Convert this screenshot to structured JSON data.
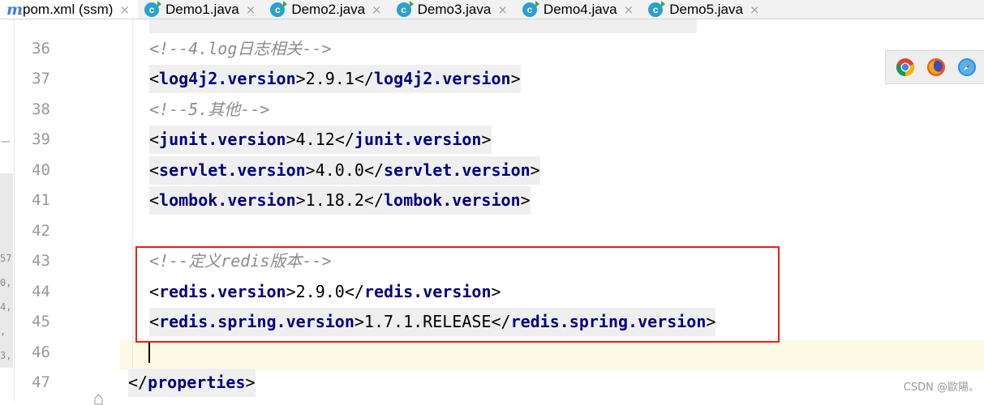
{
  "tabs": [
    {
      "label": "pom.xml (ssm)",
      "icon": "maven-file-icon",
      "active": true,
      "close": "×"
    },
    {
      "label": "Demo1.java",
      "icon": "java-class-icon",
      "close": "×"
    },
    {
      "label": "Demo2.java",
      "icon": "java-class-icon",
      "close": "×"
    },
    {
      "label": "Demo3.java",
      "icon": "java-class-icon",
      "close": "×"
    },
    {
      "label": "Demo4.java",
      "icon": "java-class-icon",
      "close": "×"
    },
    {
      "label": "Demo5.java",
      "icon": "java-class-icon",
      "close": "×"
    }
  ],
  "icons": {
    "maven": "m",
    "java_class": "c"
  },
  "left_strip_peek": [
    "57,",
    "0,",
    "4,",
    ",",
    "3,"
  ],
  "gutter": [
    "36",
    "37",
    "38",
    "39",
    "40",
    "41",
    "42",
    "43",
    "44",
    "45",
    "46",
    "47"
  ],
  "code": {
    "l36": {
      "text": "<!--4.log日志相关-->"
    },
    "l37": {
      "open": "<",
      "tag": "log4j2.version",
      "mid1": ">",
      "value": "2.9.1",
      "close_open": "</",
      "close_tag": "log4j2.version",
      "end": ">"
    },
    "l38": {
      "text": "<!--5.其他-->"
    },
    "l39": {
      "open": "<",
      "tag": "junit.version",
      "mid1": ">",
      "value": "4.12",
      "close_open": "</",
      "close_tag": "junit.version",
      "end": ">"
    },
    "l40": {
      "open": "<",
      "tag": "servlet.version",
      "mid1": ">",
      "value": "4.0.0",
      "close_open": "</",
      "close_tag": "servlet.version",
      "end": ">"
    },
    "l41": {
      "open": "<",
      "tag": "lombok.version",
      "mid1": ">",
      "value": "1.18.2",
      "close_open": "</",
      "close_tag": "lombok.version",
      "end": ">"
    },
    "l43": {
      "text": "<!--定义redis版本-->"
    },
    "l44": {
      "open": "<",
      "tag": "redis.version",
      "mid1": ">",
      "value": "2.9.0",
      "close_open": "</",
      "close_tag": "redis.version",
      "end": ">"
    },
    "l45": {
      "open": "<",
      "tag": "redis.spring.version",
      "mid1": ">",
      "value": "1.7.1.RELEASE",
      "close_open": "</",
      "close_tag": "redis.spring.version",
      "end": ">"
    },
    "l47": {
      "close_open": "</",
      "close_tag": "properties",
      "end": ">"
    }
  },
  "browsers": [
    "chrome-icon",
    "firefox-icon",
    "safari-icon"
  ],
  "colors": {
    "tag": "#000080",
    "comment": "#8c8c8c",
    "highlight_box": "#e8201a",
    "current_line": "#fcfae5"
  },
  "watermark": "CSDN @歐陽。"
}
